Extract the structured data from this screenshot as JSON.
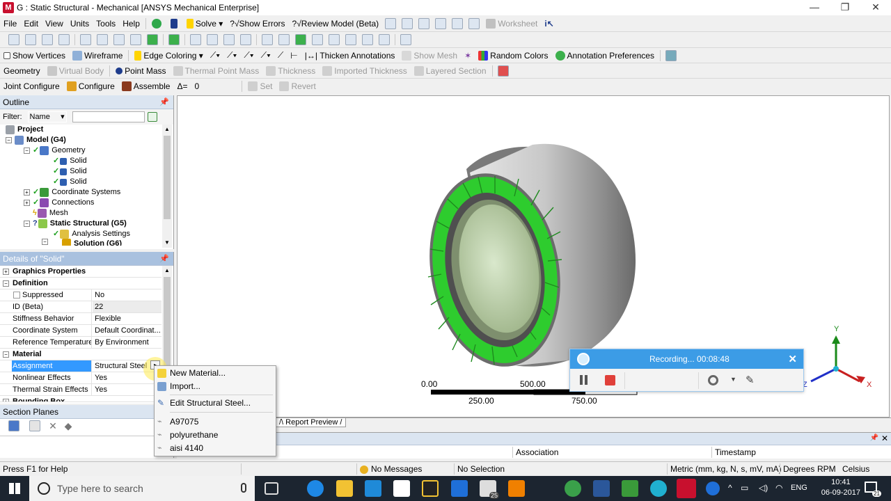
{
  "window": {
    "title": "G : Static Structural - Mechanical [ANSYS Mechanical Enterprise]",
    "logo_text": "M",
    "minimize": "—",
    "maximize": "❐",
    "close": "✕"
  },
  "menubar": {
    "items": [
      "File",
      "Edit",
      "View",
      "Units",
      "Tools",
      "Help"
    ],
    "solve": "Solve",
    "show_errors": "?√Show Errors",
    "review_model": "?√Review Model (Beta)",
    "worksheet": "Worksheet"
  },
  "toolbar3": {
    "show_vertices": "Show Vertices",
    "wireframe": "Wireframe",
    "edge_coloring": "Edge Coloring",
    "thicken_annotations": "Thicken Annotations",
    "show_mesh": "Show Mesh",
    "random_colors": "Random Colors",
    "annotation_preferences": "Annotation Preferences"
  },
  "toolbar4": {
    "geometry": "Geometry",
    "virtual_body": "Virtual Body",
    "point_mass": "Point Mass",
    "thermal_point_mass": "Thermal Point Mass",
    "thickness": "Thickness",
    "imported_thickness": "Imported Thickness",
    "layered_section": "Layered Section"
  },
  "toolbar5": {
    "joint_configure": "Joint Configure",
    "configure": "Configure",
    "assemble": "Assemble",
    "delta": "Δ=",
    "delta_value": "0",
    "set": "Set",
    "revert": "Revert"
  },
  "outline": {
    "title": "Outline",
    "filter_label": "Filter:",
    "filter_value": "Name",
    "tree": [
      {
        "label": "Project",
        "bold": true
      },
      {
        "label": "Model (G4)",
        "bold": true
      },
      {
        "label": "Geometry",
        "bold": false
      },
      {
        "label": "Solid",
        "bold": false
      },
      {
        "label": "Solid",
        "bold": false
      },
      {
        "label": "Solid",
        "bold": false
      },
      {
        "label": "Coordinate Systems",
        "bold": false
      },
      {
        "label": "Connections",
        "bold": false
      },
      {
        "label": "Mesh",
        "bold": false
      },
      {
        "label": "Static Structural (G5)",
        "bold": true
      },
      {
        "label": "Analysis Settings",
        "bold": false
      },
      {
        "label": "Solution (G6)",
        "bold": true
      }
    ]
  },
  "details": {
    "title": "Details of \"Solid\"",
    "rows": [
      {
        "key": "Graphics Properties",
        "group": true,
        "sign": "+"
      },
      {
        "key": "Definition",
        "group": true,
        "sign": "−"
      },
      {
        "key": "Suppressed",
        "value": "No"
      },
      {
        "key": "ID (Beta)",
        "value": "22"
      },
      {
        "key": "Stiffness Behavior",
        "value": "Flexible"
      },
      {
        "key": "Coordinate System",
        "value": "Default Coordinat..."
      },
      {
        "key": "Reference Temperature",
        "value": "By Environment"
      },
      {
        "key": "Material",
        "group": true,
        "sign": "−"
      },
      {
        "key": "Assignment",
        "value": "Structural Steel"
      },
      {
        "key": "Nonlinear Effects",
        "value": "Yes"
      },
      {
        "key": "Thermal Strain Effects",
        "value": "Yes"
      },
      {
        "key": "Bounding Box",
        "group": true,
        "sign": "+"
      }
    ]
  },
  "section_planes": {
    "title": "Section Planes"
  },
  "context_menu": {
    "items": [
      "New Material...",
      "Import...",
      "Edit Structural Steel...",
      "A97075",
      "polyurethane",
      "aisi 4140"
    ]
  },
  "viewport": {
    "scale_labels_top": [
      "0.00",
      "500.00"
    ],
    "scale_labels_bottom": [
      "250.00",
      "750.00"
    ],
    "axis_y": "Y",
    "axis_x": "X",
    "axis_z": "Z",
    "tab_report_preview": "Report Preview"
  },
  "recording": {
    "text": "Recording... 00:08:48",
    "close": "✕"
  },
  "messages": {
    "col_association": "Association",
    "col_timestamp": "Timestamp"
  },
  "statusbar": {
    "help": "Press F1 for Help",
    "messages": "No Messages",
    "selection": "No Selection",
    "units": "Metric (mm, kg, N, s, mV, mA)",
    "degrees": "Degrees",
    "rpm": "RPM",
    "celsius": "Celsius"
  },
  "taskbar": {
    "search_placeholder": "Type here to search",
    "time": "10:41",
    "date": "06-09-2017",
    "lang": "ENG",
    "notif_count": "21",
    "mail_badge": "25"
  },
  "colors": {
    "accent_blue": "#3399ff",
    "mesh_green": "#2ecc2e",
    "recording_blue": "#3c9ce6",
    "stop_red": "#e0403a"
  }
}
